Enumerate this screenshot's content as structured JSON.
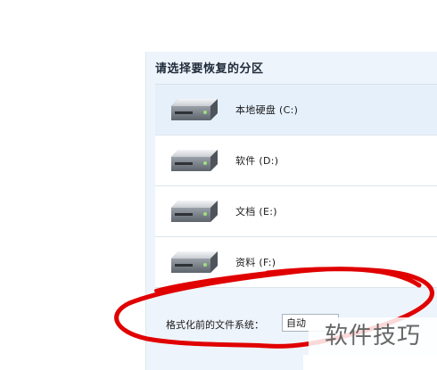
{
  "panel": {
    "title": "请选择要恢复的分区"
  },
  "drives": [
    {
      "label": "本地硬盘 (C:)",
      "icon": "hard-drive-icon",
      "selected": true
    },
    {
      "label": "软件 (D:)",
      "icon": "hard-drive-icon",
      "selected": false
    },
    {
      "label": "文档 (E:)",
      "icon": "hard-drive-icon",
      "selected": false
    },
    {
      "label": "资料 (F:)",
      "icon": "hard-drive-icon",
      "selected": false
    }
  ],
  "filesystem": {
    "label": "格式化前的文件系统：",
    "selected_value": "自动"
  },
  "watermark": {
    "text": "软件技巧"
  },
  "colors": {
    "panel_bg": "#eef4fb",
    "selected_row": "#e6f0fb",
    "scribble": "#e00000"
  }
}
